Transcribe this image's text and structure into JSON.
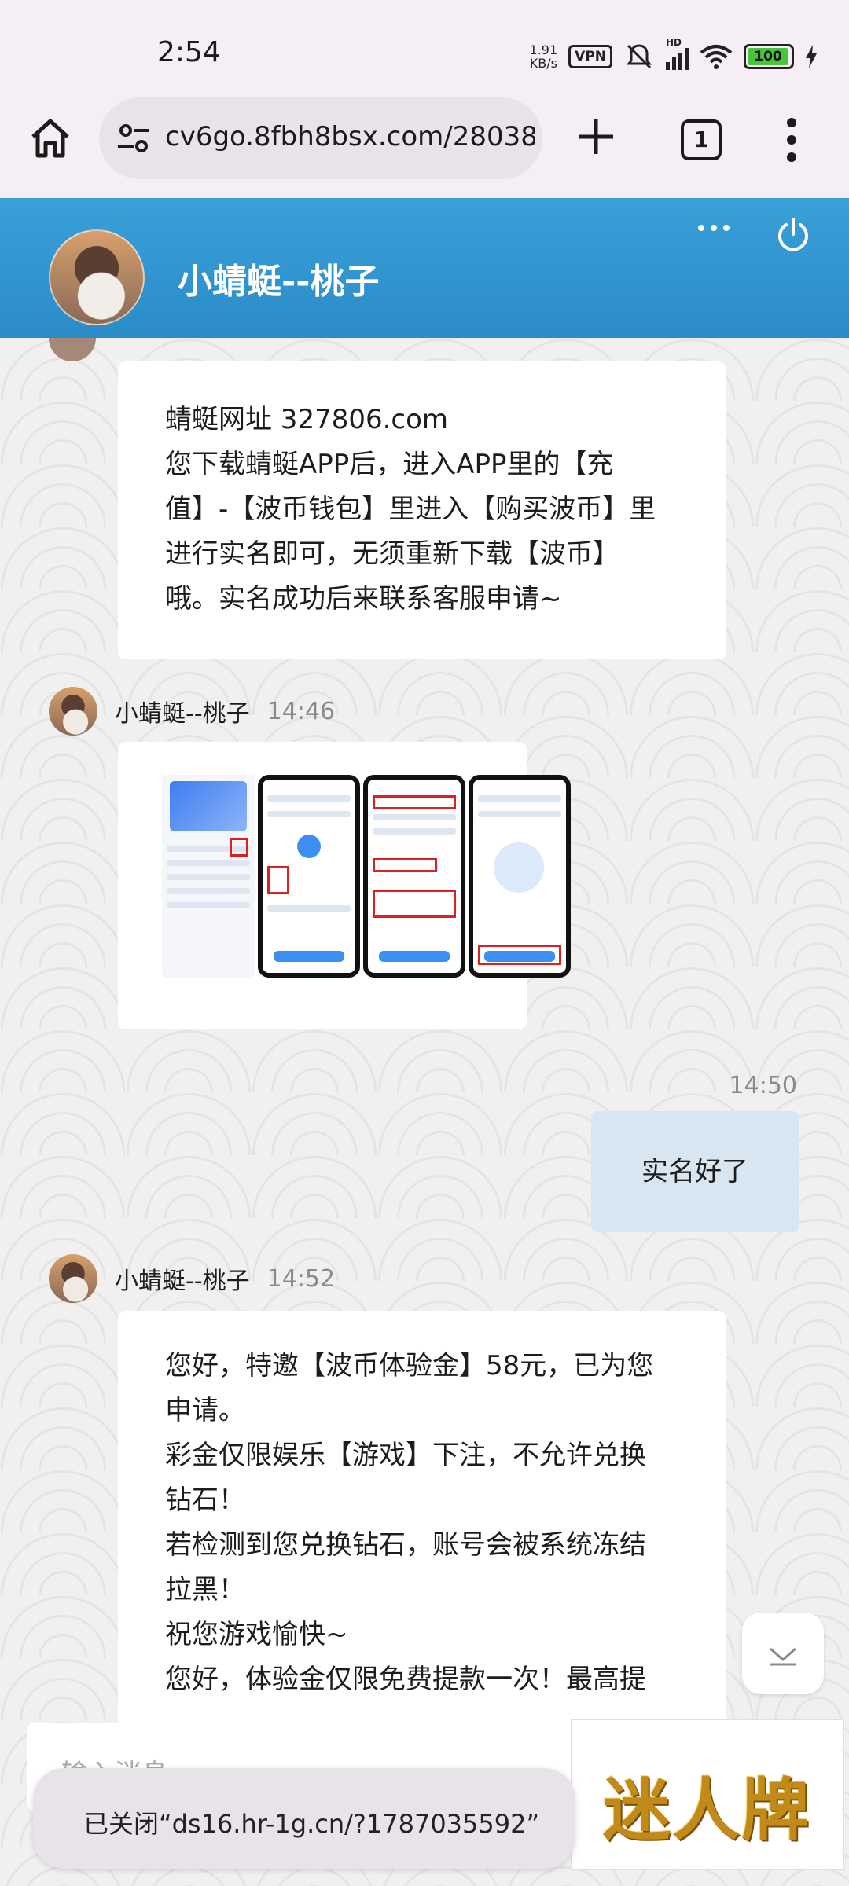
{
  "status_bar": {
    "time": "2:54",
    "net_speed_value": "1.91",
    "net_speed_unit": "KB/s",
    "vpn_label": "VPN",
    "signal_label": "HD",
    "battery_level": "100",
    "icons": [
      "mute-bell-icon",
      "signal-icon",
      "wifi-icon",
      "battery-icon",
      "charging-icon"
    ]
  },
  "browser": {
    "url": "cv6go.8fbh8bsx.com/28038",
    "tab_count": "1",
    "icons": [
      "home-icon",
      "site-settings-icon",
      "new-tab-plus-icon",
      "tab-switcher-icon",
      "menu-dots-icon"
    ]
  },
  "chat_header": {
    "title": "小蜻蜓--桃子",
    "accent": "#3399d4"
  },
  "messages": {
    "m1": {
      "lines": [
        "蜻蜓网址 327806.com",
        "您下载蜻蜓APP后，进入APP里的【充",
        "值】-【波币钱包】里进入【购买波币】里",
        "进行实名即可，无须重新下载【波币】",
        "哦。实名成功后来联系客服申请~"
      ]
    },
    "m2": {
      "sender": "小蜻蜓--桃子",
      "time": "14:46",
      "image_caption": ""
    },
    "m3": {
      "time": "14:50",
      "text": "实名好了"
    },
    "m4": {
      "sender": "小蜻蜓--桃子",
      "time": "14:52",
      "lines": [
        "您好，特邀【波币体验金】58元，已为您",
        "申请。",
        "彩金仅限娱乐【游戏】下注，不允许兑换",
        "钻石！",
        "若检测到您兑换钻石，账号会被系统冻结",
        "拉黑！",
        "祝您游戏愉快~",
        "您好，体验金仅限免费提款一次！最高提"
      ]
    }
  },
  "input": {
    "placeholder": "输入消息"
  },
  "ad": {
    "text": "迷人牌"
  },
  "toast": {
    "text": "已关闭“ds16.hr-1g.cn/?1787035592”"
  }
}
